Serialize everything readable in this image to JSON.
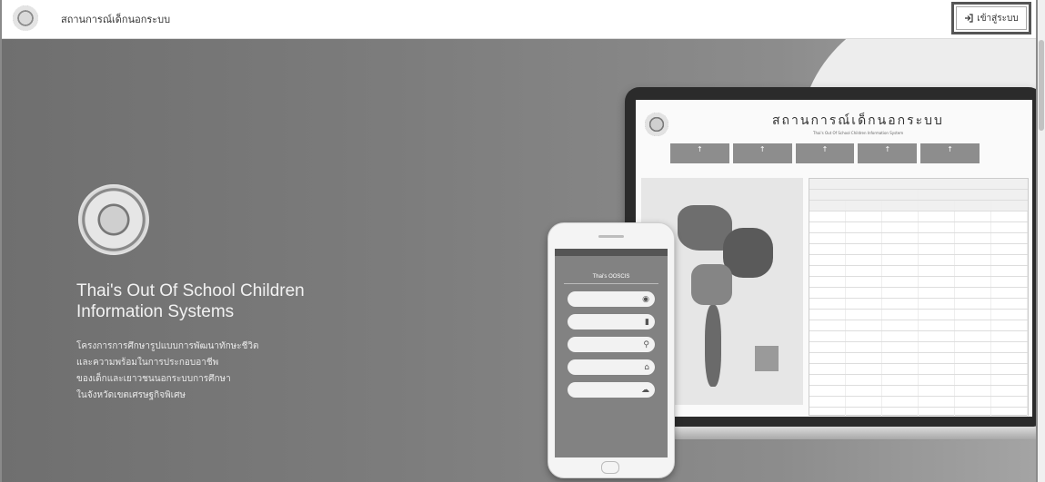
{
  "header": {
    "site_name": "สถานการณ์เด็กนอกระบบ",
    "login_icon": "login-arrow-icon",
    "login_label": "เข้าสู่ระบบ"
  },
  "hero": {
    "title_line1": "Thai's Out Of School Children",
    "title_line2": "Information Systems",
    "description": [
      "โครงการการศึกษารูปแบบการพัฒนาทักษะชีวิต",
      "และความพร้อมในการประกอบอาชีพ",
      "ของเด็กและเยาวชนนอกระบบการศึกษา",
      "ในจังหวัดเขตเศรษฐกิจพิเศษ"
    ]
  },
  "laptop": {
    "title": "สถานการณ์เด็กนอกระบบ",
    "subtitle": "Thai's Out Of School Children Information System"
  },
  "phone": {
    "brand": "Thai's OOSCIS",
    "buttons": [
      {
        "icon": "eye-icon"
      },
      {
        "icon": "book-icon"
      },
      {
        "icon": "search-icon"
      },
      {
        "icon": "home-icon"
      },
      {
        "icon": "cloud-icon"
      }
    ]
  },
  "colors": {
    "hero_bg": "#7d7d7d",
    "header_bg": "#ffffff"
  }
}
